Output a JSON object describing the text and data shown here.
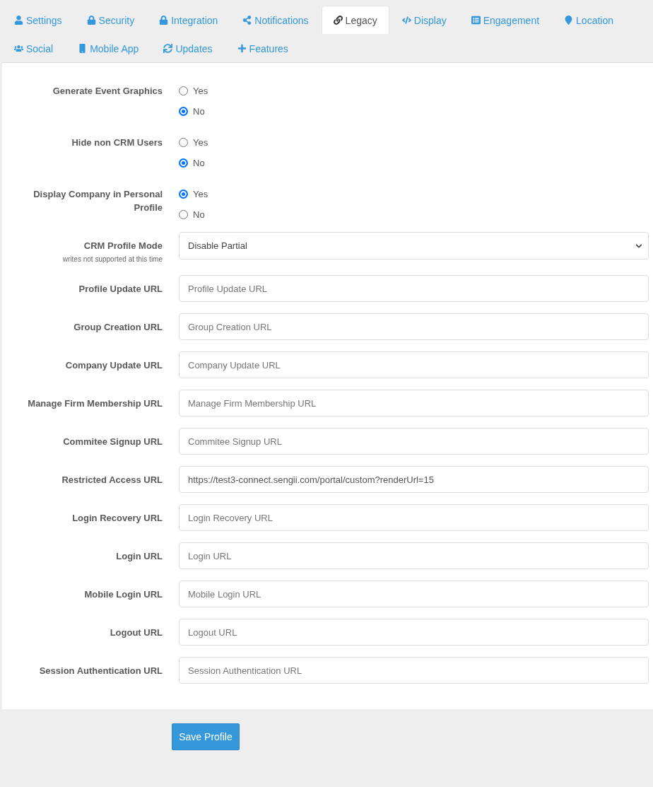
{
  "tab_rows": [
    {
      "tabs": [
        {
          "label": "Settings",
          "selected": false
        },
        {
          "label": "Security",
          "selected": false
        },
        {
          "label": "Integration",
          "selected": false
        },
        {
          "label": "Notifications",
          "selected": false
        },
        {
          "label": "Legacy",
          "selected": true
        },
        {
          "label": "Display",
          "selected": false
        },
        {
          "label": "Engagement",
          "selected": false
        },
        {
          "label": "Location",
          "selected": false
        }
      ]
    },
    {
      "tabs": [
        {
          "label": "Social",
          "selected": false
        },
        {
          "label": "Mobile App",
          "selected": false
        },
        {
          "label": "Updates",
          "selected": false
        },
        {
          "label": "Features",
          "selected": false
        }
      ]
    }
  ],
  "form": {
    "fields": [
      {
        "kind": "radio",
        "label": "Generate Event Graphics",
        "options": [
          {
            "label": "Yes",
            "selected": false
          },
          {
            "label": "No",
            "selected": true
          }
        ]
      },
      {
        "kind": "radio",
        "label": "Hide non CRM Users",
        "options": [
          {
            "label": "Yes",
            "selected": false
          },
          {
            "label": "No",
            "selected": true
          }
        ]
      },
      {
        "kind": "radio",
        "label": "Display Company in Personal Profile",
        "options": [
          {
            "label": "Yes",
            "selected": true
          },
          {
            "label": "No",
            "selected": false
          }
        ]
      },
      {
        "kind": "select",
        "label": "CRM Profile Mode",
        "note": "writes not supported at this time",
        "value": "Disable Partial"
      },
      {
        "kind": "text",
        "label": "Profile Update URL",
        "placeholder": "Profile Update URL"
      },
      {
        "kind": "text",
        "label": "Group Creation URL",
        "placeholder": "Group Creation URL"
      },
      {
        "kind": "text",
        "label": "Company Update URL",
        "placeholder": "Company Update URL"
      },
      {
        "kind": "text",
        "label": "Manage Firm Membership URL",
        "placeholder": "Manage Firm Membership URL"
      },
      {
        "kind": "text",
        "label": "Commitee Signup URL",
        "placeholder": "Commitee Signup URL"
      },
      {
        "kind": "text",
        "label": "Restricted Access URL",
        "value": "https://test3-connect.sengii.com/portal/custom?renderUrl=15"
      },
      {
        "kind": "text",
        "label": "Login Recovery URL",
        "placeholder": "Login Recovery URL"
      },
      {
        "kind": "text",
        "label": "Login URL",
        "placeholder": "Login URL"
      },
      {
        "kind": "text",
        "label": "Mobile Login URL",
        "placeholder": "Mobile Login URL"
      },
      {
        "kind": "text",
        "label": "Logout URL",
        "placeholder": "Logout URL"
      },
      {
        "kind": "text",
        "label": "Session Authentication URL",
        "placeholder": "Session Authentication URL"
      }
    ]
  },
  "save_button": {
    "label": "Save Profile"
  }
}
